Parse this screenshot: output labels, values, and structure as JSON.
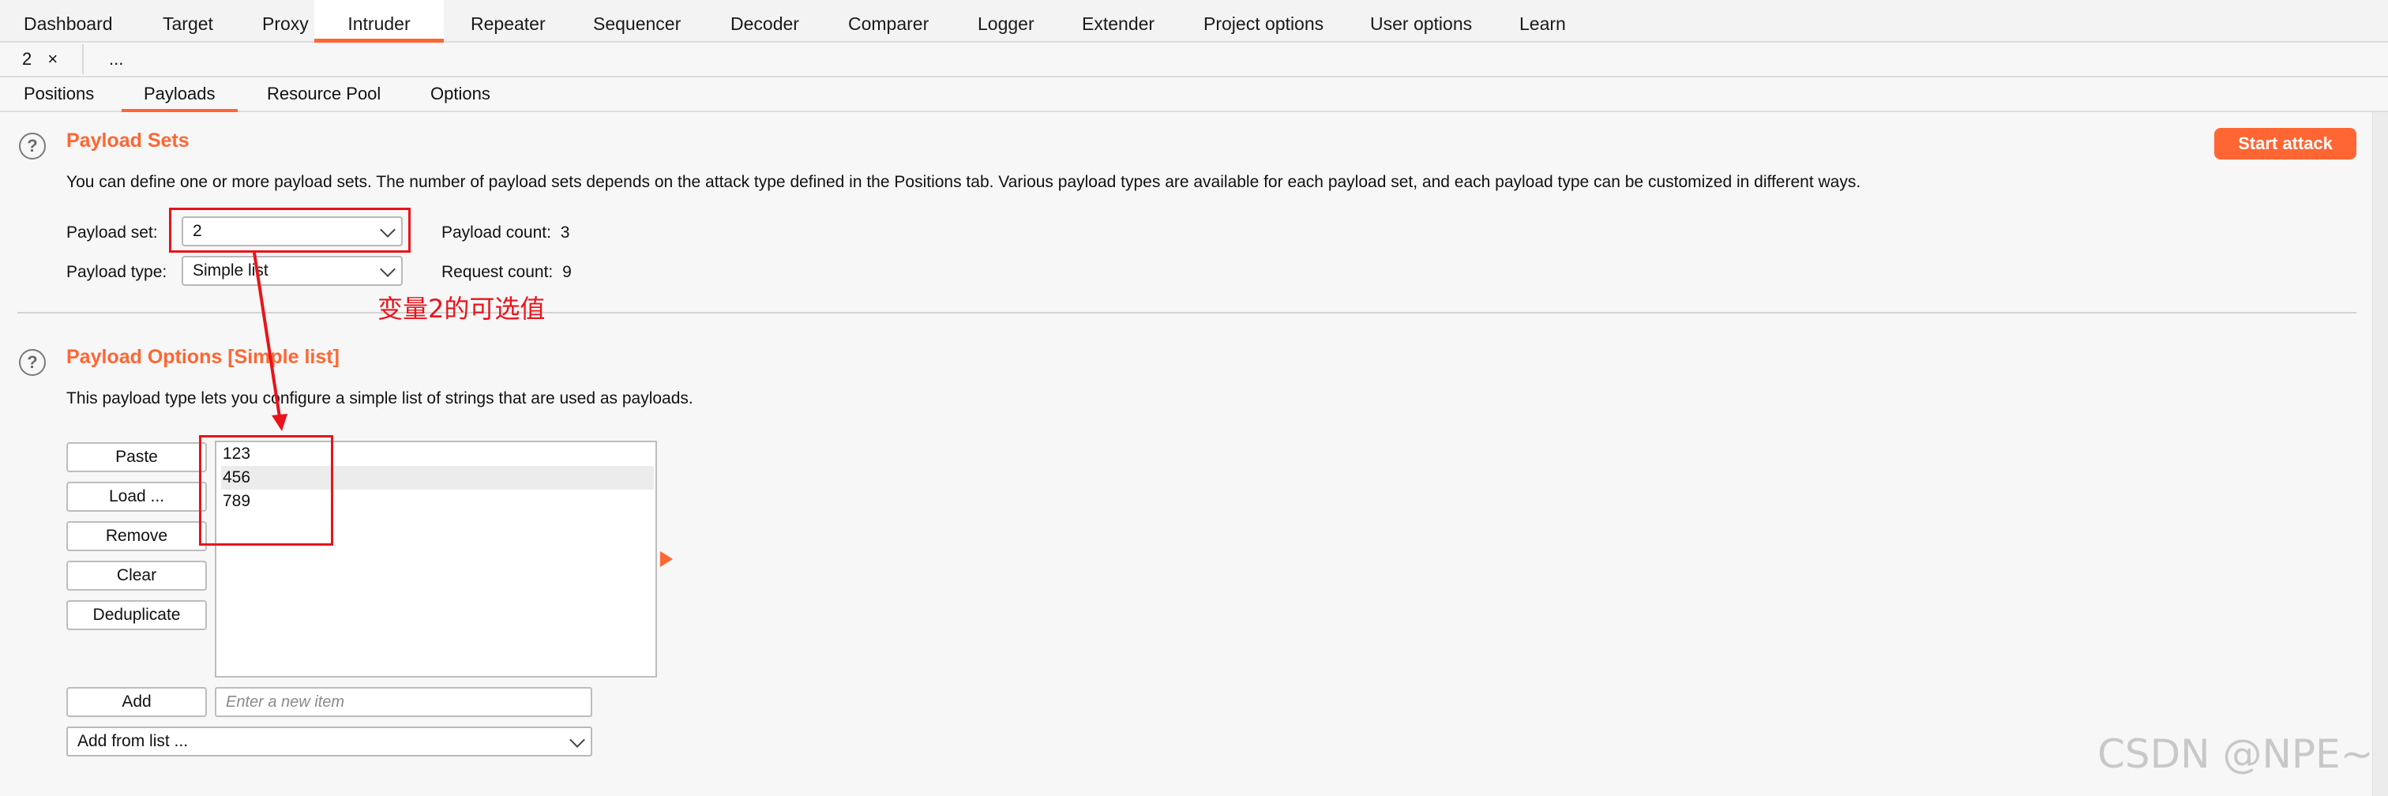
{
  "top_tabs": {
    "items": [
      "Dashboard",
      "Target",
      "Proxy",
      "Intruder",
      "Repeater",
      "Sequencer",
      "Decoder",
      "Comparer",
      "Logger",
      "Extender",
      "Project options",
      "User options",
      "Learn"
    ],
    "active": "Intruder"
  },
  "instance_tabs": {
    "current": "2",
    "close": "×",
    "more": "..."
  },
  "sub_tabs": {
    "items": [
      "Positions",
      "Payloads",
      "Resource Pool",
      "Options"
    ],
    "active": "Payloads"
  },
  "payload_sets": {
    "title": "Payload Sets",
    "description": "You can define one or more payload sets. The number of payload sets depends on the attack type defined in the Positions tab. Various payload types are available for each payload set, and each payload type can be customized in different ways.",
    "set_label": "Payload set:",
    "set_value": "2",
    "type_label": "Payload type:",
    "type_value": "Simple list",
    "count_label": "Payload count:",
    "count_value": "3",
    "request_label": "Request count:",
    "request_value": "9",
    "start_attack": "Start attack"
  },
  "annotation": {
    "text": "变量2的可选值",
    "color": "#e8141b"
  },
  "payload_options": {
    "title": "Payload Options [Simple list]",
    "description": "This payload type lets you configure a simple list of strings that are used as payloads.",
    "buttons": {
      "paste": "Paste",
      "load": "Load ...",
      "remove": "Remove",
      "clear": "Clear",
      "deduplicate": "Deduplicate",
      "add": "Add"
    },
    "items": [
      "123",
      "456",
      "789"
    ],
    "add_placeholder": "Enter a new item",
    "add_from_list": "Add from list ..."
  },
  "help_icon": "?",
  "watermark": "CSDN @NPE~",
  "colors": {
    "accent": "#ff6633",
    "annotation_red": "#e8141b"
  }
}
